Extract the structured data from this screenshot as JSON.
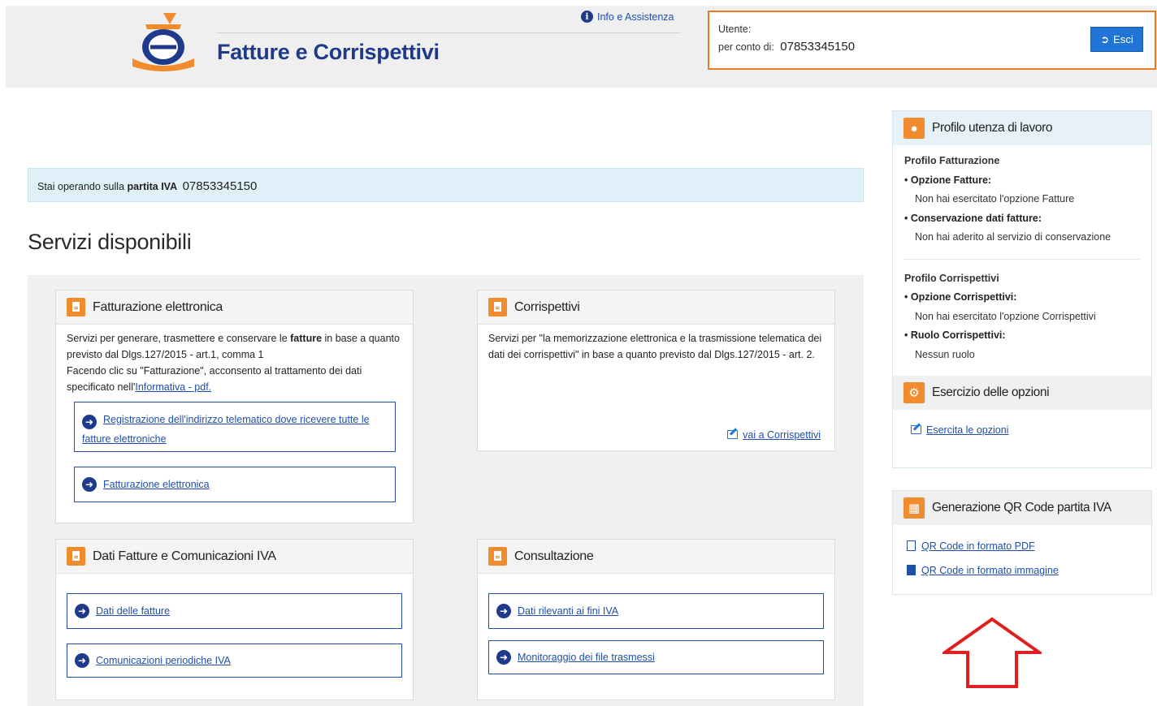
{
  "header": {
    "app_title": "Fatture e Corrispettivi",
    "info_link": "Info e Assistenza",
    "user_label": "Utente:",
    "conto_label": "per conto di:",
    "conto_piva": "07853345150",
    "logout_label": "Esci"
  },
  "notice": {
    "prefix": "Stai operando sulla",
    "bold": "partita IVA",
    "piva": "07853345150"
  },
  "section_title": "Servizi disponibili",
  "cards": {
    "fatturazione": {
      "title": "Fatturazione elettronica",
      "desc_1a": "Servizi per generare, trasmettere e conservare le ",
      "desc_1b": "fatture",
      "desc_1c": " in base a quanto previsto dal Dlgs.127/2015 - art.1, comma 1",
      "desc_2": "Facendo clic su \"Fatturazione\", acconsento al trattamento dei dati specificato nell'",
      "desc_link": "Informativa - pdf.",
      "link_registrazione": "Registrazione dell'indirizzo telematico dove ricevere tutte le fatture elettroniche",
      "link_fatturazione": "Fatturazione elettronica"
    },
    "corrispettivi": {
      "title": "Corrispettivi",
      "desc": "Servizi per \"la memorizzazione elettronica e la trasmissione telematica dei dati dei corrispettivi\" in base a quanto previsto dal Dlgs.127/2015 - art. 2.",
      "link": "vai a Corrispettivi"
    },
    "dati": {
      "title": "Dati Fatture e Comunicazioni IVA",
      "link_dati": "Dati delle fatture",
      "link_comunicazioni": "Comunicazioni periodiche IVA"
    },
    "consultazione": {
      "title": "Consultazione",
      "link_dati_iva": "Dati rilevanti ai fini IVA",
      "link_monitoraggio": "Monitoraggio dei file trasmessi"
    }
  },
  "profilo": {
    "title": "Profilo utenza di lavoro",
    "fatt_heading": "Profilo Fatturazione",
    "opz_fatture_label": "Opzione Fatture:",
    "opz_fatture_val": "Non hai esercitato l'opzione Fatture",
    "cons_label": "Conservazione dati fatture:",
    "cons_val": "Non hai aderito al servizio di conservazione",
    "corr_heading": "Profilo Corrispettivi",
    "opz_corr_label": "Opzione Corrispettivi:",
    "opz_corr_val": "Non hai esercitato l'opzione Corrispettivi",
    "ruolo_label": "Ruolo Corrispettivi:",
    "ruolo_val": "Nessun ruolo"
  },
  "opzioni": {
    "title": "Esercizio delle opzioni",
    "link": "Esercita le opzioni"
  },
  "qr": {
    "title": "Generazione QR Code partita IVA",
    "link_pdf": "QR Code in formato PDF",
    "link_img": "QR Code in formato immagine"
  },
  "colors": {
    "accent_orange": "#f08c2e",
    "link_blue": "#1f4fa8",
    "title_blue": "#1f3a8a",
    "button_blue": "#1f74d6",
    "arrow_red": "#e02020"
  },
  "icons": [
    "info-icon",
    "logout-icon",
    "document-icon",
    "arrow-right-circle-icon",
    "edit-icon",
    "person-icon",
    "gear-icon",
    "qr-icon",
    "pdf-icon",
    "image-icon",
    "red-up-arrow-icon"
  ]
}
